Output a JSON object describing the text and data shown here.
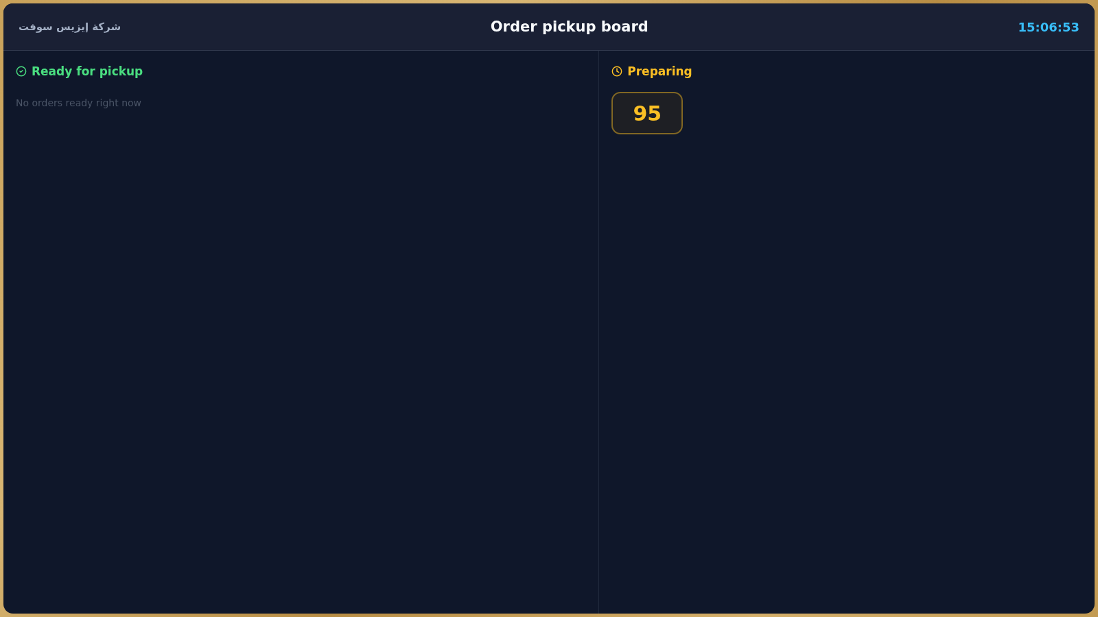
{
  "header": {
    "brand": "شركة إيزيس سوفت",
    "title": "Order pickup board",
    "time": "15:06:53"
  },
  "columns": [
    {
      "kind": "ready",
      "title": "Ready for pickup",
      "color": "#4ade80",
      "empty_message": "No orders ready right now"
    },
    {
      "kind": "preparing",
      "title": "Preparing",
      "color": "#fbbf24",
      "orders": [
        {
          "number": "95"
        }
      ]
    }
  ]
}
